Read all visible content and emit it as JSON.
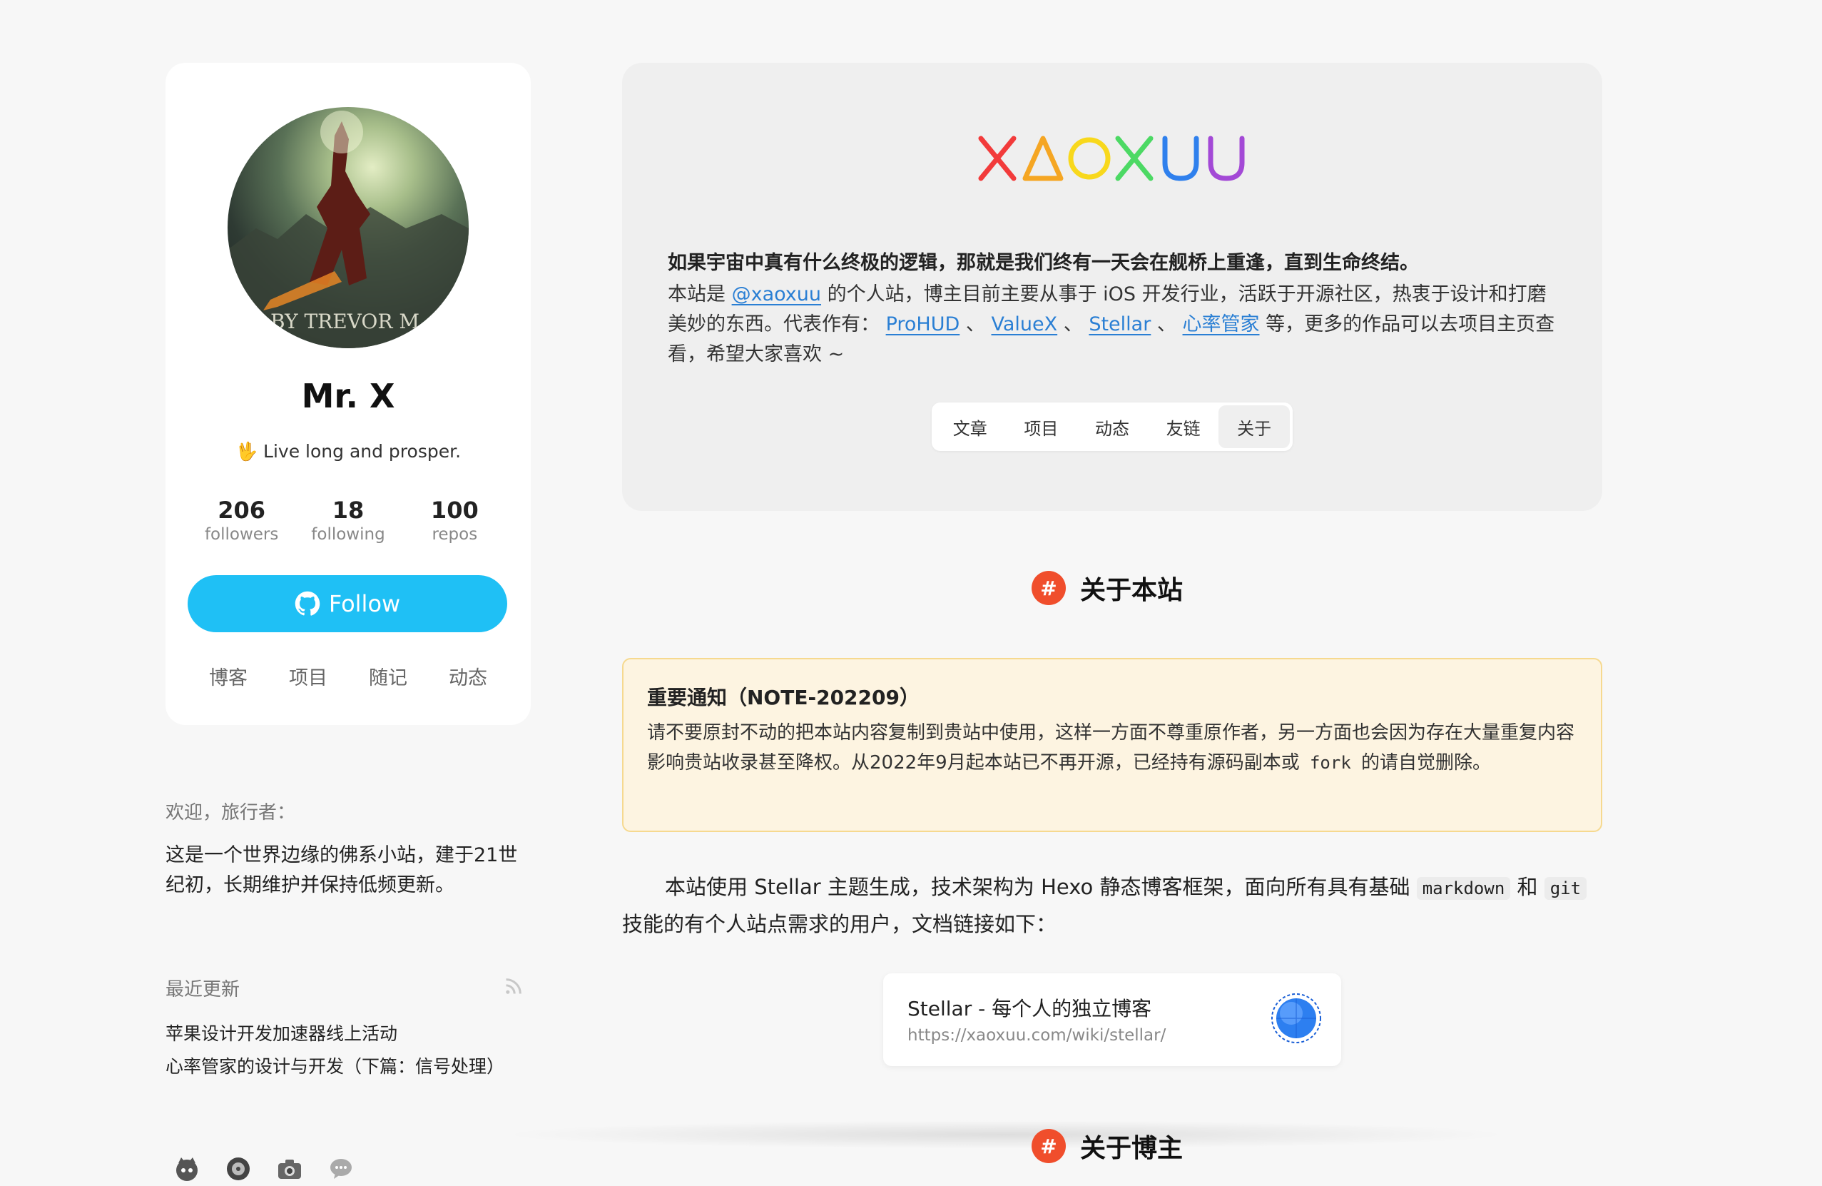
{
  "profile": {
    "name": "Mr. X",
    "bio": "🖖 Live long and prosper.",
    "avatar_text": "BY TREVOR M",
    "stats": [
      {
        "value": "206",
        "label": "followers"
      },
      {
        "value": "18",
        "label": "following"
      },
      {
        "value": "100",
        "label": "repos"
      }
    ],
    "follow_label": "Follow",
    "nav": [
      "博客",
      "项目",
      "随记",
      "动态"
    ]
  },
  "welcome": {
    "title": "欢迎，旅行者：",
    "text": "这是一个世界边缘的佛系小站，建于21世纪初，长期维护并保持低频更新。"
  },
  "recent": {
    "title": "最近更新",
    "items": [
      "苹果设计开发加速器线上活动",
      "心率管家的设计与开发（下篇：信号处理）"
    ]
  },
  "social_icons": [
    "github-icon",
    "music-icon",
    "camera-icon",
    "chat-icon"
  ],
  "header": {
    "logo_letters": [
      "X",
      "Δ",
      "O",
      "X",
      "U",
      "U"
    ],
    "logo_colors": [
      "#f23b3b",
      "#f5a623",
      "#f8d81c",
      "#4cd964",
      "#2f80ed",
      "#a349d6"
    ],
    "motto": "如果宇宙中真有什么终极的逻辑，那就是我们终有一天会在舰桥上重逢，直到生命终结。",
    "intro": {
      "p1": "本站是 ",
      "handle": "@xaoxuu",
      "p2": " 的个人站，博主目前主要从事于 iOS 开发行业，活跃于开源社区，热衷于设计和打磨美妙的东西。代表作有： ",
      "works": [
        "ProHUD",
        "ValueX",
        "Stellar",
        "心率管家"
      ],
      "sep": " 、",
      "p3": " 等，更多的作品可以去项目主页查看，希望大家喜欢 ~"
    },
    "tabs": [
      "文章",
      "项目",
      "动态",
      "友链",
      "关于"
    ],
    "active_tab": "关于"
  },
  "section": {
    "heading": "关于本站",
    "hash": "#",
    "note_title": "重要通知（NOTE-202209）",
    "note_before": "请不要原封不动的把本站内容复制到贵站中使用，这样一方面不尊重原作者，另一方面也会因为存在大量重复内容影响贵站收录甚至降权。从2022年9月起本站已不再开源，已经持有源码副本或 ",
    "note_code": "fork",
    "note_after": " 的请自觉删除。",
    "para_a": "本站使用 Stellar 主题生成，技术架构为 Hexo 静态博客框架，面向所有具有基础 ",
    "code1": "markdown",
    "para_b": " 和 ",
    "code2": "git",
    "para_c": " 技能的有个人站点需求的用户，文档链接如下：",
    "link_title": "Stellar - 每个人的独立博客",
    "link_url": "https://xaoxuu.com/wiki/stellar/",
    "next_heading": "关于博主"
  }
}
